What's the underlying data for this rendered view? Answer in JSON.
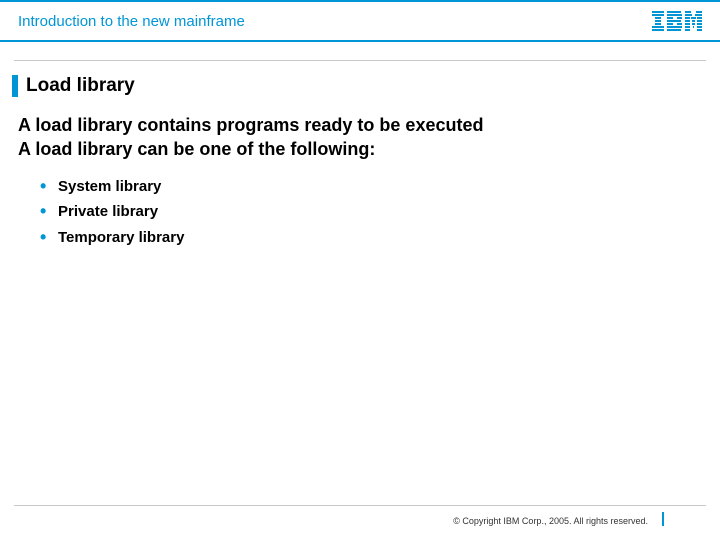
{
  "header": {
    "title": "Introduction to the new mainframe",
    "logo_name": "IBM"
  },
  "slide": {
    "title": "Load library",
    "lead1": "A load library contains programs ready to be executed",
    "lead2": "A load library can be one of the following:",
    "bullets": [
      "System library",
      "Private library",
      "Temporary library"
    ]
  },
  "footer": {
    "copyright": "© Copyright IBM Corp., 2005. All rights reserved."
  }
}
